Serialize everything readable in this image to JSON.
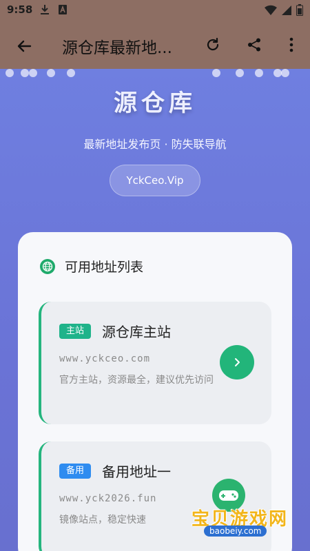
{
  "status_bar": {
    "time": "9:58",
    "icons": [
      "download-icon",
      "app-a-icon",
      "wifi-icon",
      "signal-icon",
      "battery-icon"
    ]
  },
  "app_bar": {
    "title": "源仓库最新地...",
    "back_icon": "arrow-left-icon",
    "actions": [
      "refresh-icon",
      "share-icon",
      "more-vertical-icon"
    ]
  },
  "hero": {
    "brand": "源仓库",
    "subtitle": "最新地址发布页 · 防失联导航",
    "domain": "YckCeo.Vip"
  },
  "address_list": {
    "title": "可用地址列表",
    "icon": "globe-icon",
    "entries": [
      {
        "badge": "主站",
        "badge_color": "#1fb38a",
        "name": "源仓库主站",
        "url": "www.yckceo.com",
        "description": "官方主站，资源最全，建议优先访问",
        "action_icon": "chevron-right-icon"
      },
      {
        "badge": "备用",
        "badge_color": "#2f8cf0",
        "name": "备用地址一",
        "url": "www.yck2026.fun",
        "description": "镜像站点，稳定快速",
        "action_icon": "chevron-right-icon"
      }
    ]
  },
  "watermark": {
    "text": "宝贝游戏网",
    "url": "baobeiy.com",
    "icon": "gamepad-icon"
  },
  "colors": {
    "app_bar": "#8d6e63",
    "hero_gradient": "#6f7fe0",
    "accent_green": "#22b57a"
  }
}
